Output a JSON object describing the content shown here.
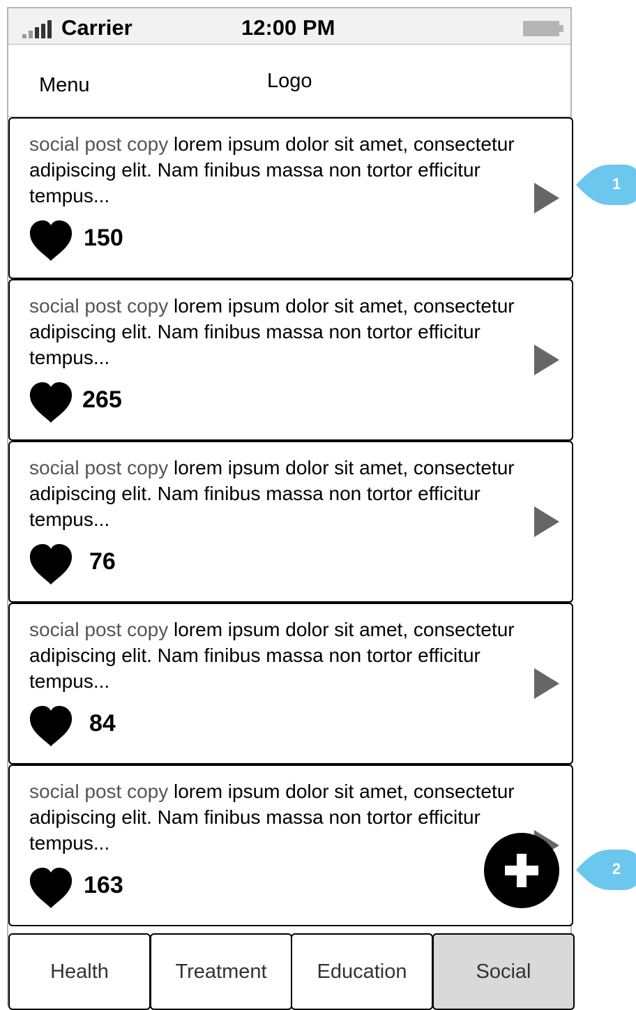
{
  "status_bar": {
    "carrier": "Carrier",
    "time": "12:00 PM"
  },
  "nav": {
    "menu_label": "Menu",
    "logo_label": "Logo"
  },
  "posts": [
    {
      "lead": "social post copy",
      "body": " lorem ipsum dolor sit amet, consectetur adipiscing elit. Nam finibus massa non tortor efficitur tempus...",
      "likes": "150"
    },
    {
      "lead": "social post copy",
      "body": " lorem ipsum dolor sit amet, consectetur adipiscing elit. Nam finibus massa non tortor efficitur tempus...",
      "likes": "265"
    },
    {
      "lead": "social post copy",
      "body": " lorem ipsum dolor sit amet, consectetur adipiscing elit. Nam finibus massa non tortor efficitur tempus...",
      "likes": "76"
    },
    {
      "lead": "social post copy",
      "body": " lorem ipsum dolor sit amet, consectetur adipiscing elit. Nam finibus massa non tortor efficitur tempus...",
      "likes": "84"
    },
    {
      "lead": "social post copy",
      "body": " lorem ipsum dolor sit amet, consectetur adipiscing elit. Nam finibus massa non tortor efficitur tempus...",
      "likes": "163"
    }
  ],
  "tabs": [
    {
      "label": "Health",
      "active": false
    },
    {
      "label": "Treatment",
      "active": false
    },
    {
      "label": "Education",
      "active": false
    },
    {
      "label": "Social",
      "active": true
    }
  ],
  "annotations": [
    {
      "label": "1"
    },
    {
      "label": "2"
    }
  ],
  "icons": {
    "heart": "heart-icon",
    "chevron": "chevron-right-icon",
    "add": "plus-icon",
    "signal": "signal-icon",
    "battery": "battery-icon"
  },
  "colors": {
    "callout": "#6cc7ef",
    "active_tab": "#d9d9d9",
    "arrow": "#666666",
    "lead_text": "#555555"
  }
}
